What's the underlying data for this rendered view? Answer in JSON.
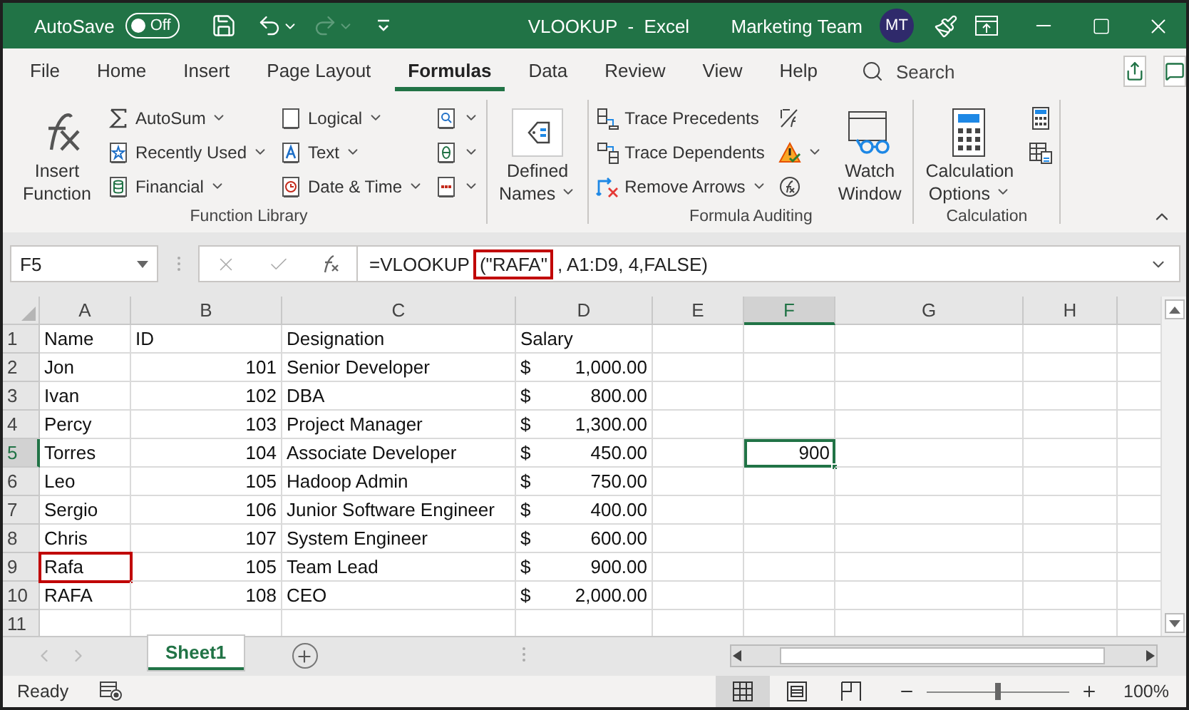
{
  "title_bar": {
    "autosave_label": "AutoSave",
    "autosave": {
      "on": false,
      "label": "Off"
    },
    "title": "VLOOKUP  -  Excel",
    "account": "Marketing Team",
    "avatar": "MT"
  },
  "tabs": [
    {
      "label": "File",
      "selected": false
    },
    {
      "label": "Home",
      "selected": false
    },
    {
      "label": "Insert",
      "selected": false
    },
    {
      "label": "Page Layout",
      "selected": false
    },
    {
      "label": "Formulas",
      "selected": true
    },
    {
      "label": "Data",
      "selected": false
    },
    {
      "label": "Review",
      "selected": false
    },
    {
      "label": "View",
      "selected": false
    },
    {
      "label": "Help",
      "selected": false
    }
  ],
  "search": {
    "placeholder": "Search"
  },
  "ribbon": {
    "groups": [
      {
        "label": "Function Library",
        "columns": [
          [
            {
              "kind": "large",
              "lines": [
                "Insert",
                "Function"
              ],
              "dropdown": false
            }
          ],
          [
            {
              "kind": "small",
              "label": "AutoSum",
              "dropdown": true
            },
            {
              "kind": "small",
              "label": "Recently Used",
              "dropdown": true
            },
            {
              "kind": "small",
              "label": "Financial",
              "dropdown": true
            }
          ],
          [
            {
              "kind": "small",
              "label": "Logical",
              "dropdown": true
            },
            {
              "kind": "small",
              "label": "Text",
              "dropdown": true
            },
            {
              "kind": "small",
              "label": "Date & Time",
              "dropdown": true
            }
          ],
          [
            {
              "kind": "icon",
              "dropdown": true
            },
            {
              "kind": "icon",
              "dropdown": true
            },
            {
              "kind": "icon",
              "dropdown": true
            }
          ]
        ]
      },
      {
        "columns": [
          [
            {
              "kind": "large",
              "lines": [
                "Defined",
                "Names"
              ],
              "dropdown": true
            }
          ]
        ]
      },
      {
        "label": "Formula Auditing",
        "columns": [
          [
            {
              "kind": "small",
              "label": "Trace Precedents",
              "dropdown": false
            },
            {
              "kind": "small",
              "label": "Trace Dependents",
              "dropdown": false
            },
            {
              "kind": "small",
              "label": "Remove Arrows",
              "dropdown": true
            }
          ],
          [
            {
              "kind": "icon",
              "dropdown": false
            },
            {
              "kind": "icon",
              "dropdown": true
            },
            {
              "kind": "icon",
              "dropdown": false
            }
          ],
          [
            {
              "kind": "large",
              "lines": [
                "Watch",
                "Window"
              ],
              "dropdown": false
            }
          ]
        ]
      },
      {
        "label": "Calculation",
        "columns": [
          [
            {
              "kind": "large",
              "lines": [
                "Calculation",
                "Options"
              ],
              "dropdown": true
            }
          ],
          [
            {
              "kind": "icon",
              "dropdown": false
            },
            {
              "kind": "icon",
              "dropdown": false
            }
          ]
        ]
      }
    ]
  },
  "formula_bar": {
    "name_box": "F5",
    "formula": [
      {
        "text": "=VLOOKUP",
        "highlighted": false
      },
      {
        "text": "(\"RAFA\"",
        "highlighted": true
      },
      {
        "text": ", A1:D9, 4,FALSE)",
        "highlighted": false
      }
    ]
  },
  "columns": [
    {
      "label": "A",
      "selected": false
    },
    {
      "label": "B",
      "selected": false
    },
    {
      "label": "C",
      "selected": false
    },
    {
      "label": "D",
      "selected": false
    },
    {
      "label": "E",
      "selected": false
    },
    {
      "label": "F",
      "selected": true
    },
    {
      "label": "G",
      "selected": false
    },
    {
      "label": "H",
      "selected": false
    }
  ],
  "rows": [
    {
      "number": "1",
      "selected": false,
      "kind": "labels",
      "name_label": "Name",
      "id_label": "ID",
      "designation_label": "Designation",
      "salary_label": "Salary"
    },
    {
      "number": "2",
      "selected": false,
      "kind": "record",
      "name": "Jon",
      "id": "101",
      "designation": "Senior Developer",
      "currency": "$",
      "salary": "1,000.00"
    },
    {
      "number": "3",
      "selected": false,
      "kind": "record",
      "name": "Ivan",
      "id": "102",
      "designation": "DBA",
      "currency": "$",
      "salary": "800.00"
    },
    {
      "number": "4",
      "selected": false,
      "kind": "record",
      "name": "Percy",
      "id": "103",
      "designation": "Project Manager",
      "currency": "$",
      "salary": "1,300.00"
    },
    {
      "number": "5",
      "selected": true,
      "kind": "record",
      "name": "Torres",
      "id": "104",
      "designation": "Associate Developer",
      "currency": "$",
      "salary": "450.00",
      "column_f": "900",
      "column_f_selected": true
    },
    {
      "number": "6",
      "selected": false,
      "kind": "record",
      "name": "Leo",
      "id": "105",
      "designation": "Hadoop Admin",
      "currency": "$",
      "salary": "750.00"
    },
    {
      "number": "7",
      "selected": false,
      "kind": "record",
      "name": "Sergio",
      "id": "106",
      "designation": "Junior Software Engineer",
      "currency": "$",
      "salary": "400.00"
    },
    {
      "number": "8",
      "selected": false,
      "kind": "record",
      "name": "Chris",
      "id": "107",
      "designation": "System Engineer",
      "currency": "$",
      "salary": "600.00"
    },
    {
      "number": "9",
      "selected": false,
      "kind": "record",
      "name": "Rafa",
      "name_highlighted": true,
      "id": "105",
      "designation": "Team Lead",
      "currency": "$",
      "salary": "900.00"
    },
    {
      "number": "10",
      "selected": false,
      "kind": "record",
      "name": "RAFA",
      "id": "108",
      "designation": "CEO",
      "currency": "$",
      "salary": "2,000.00"
    },
    {
      "number": "11",
      "selected": false,
      "kind": "empty"
    }
  ],
  "sheet_tabs": [
    {
      "label": "Sheet1",
      "selected": true
    }
  ],
  "status_bar": {
    "status": "Ready",
    "views": [
      {
        "selected": true
      },
      {
        "selected": false
      },
      {
        "selected": false
      }
    ],
    "zoom": {
      "level": 0.5,
      "label": "100%"
    }
  }
}
